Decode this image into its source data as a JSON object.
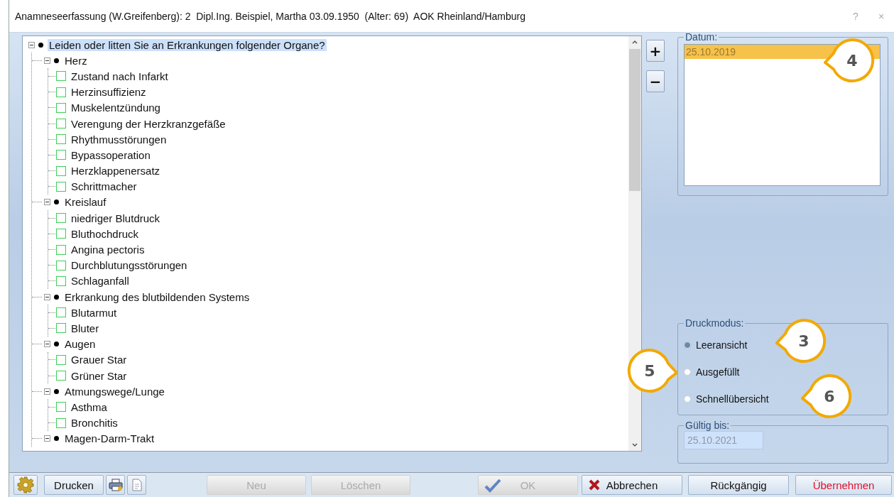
{
  "window": {
    "title": "Anamneseerfassung (W.Greifenberg): 2  Dipl.Ing. Beispiel, Martha 03.09.1950  (Alter: 69)  AOK Rheinland/Hamburg",
    "help": "?",
    "close": "×"
  },
  "tree": [
    {
      "label": "Leiden oder litten  Sie an Erkrankungen folgender Organe?",
      "expanded": true,
      "selected": true,
      "children": [
        {
          "label": "Herz",
          "expanded": true,
          "selected": false,
          "children": [
            {
              "label": "Zustand nach Infarkt",
              "checked": false,
              "selected": false
            },
            {
              "label": "Herzinsuffizienz",
              "checked": false,
              "selected": false
            },
            {
              "label": "Muskelentzündung",
              "checked": false,
              "selected": false
            },
            {
              "label": "Verengung der Herzkranzgefäße",
              "checked": false,
              "selected": false
            },
            {
              "label": "Rhythmusstörungen",
              "checked": false,
              "selected": false
            },
            {
              "label": "Bypassoperation",
              "checked": false,
              "selected": false
            },
            {
              "label": "Herzklappenersatz",
              "checked": false,
              "selected": false
            },
            {
              "label": "Schrittmacher",
              "checked": false,
              "selected": false
            }
          ]
        },
        {
          "label": "Kreislauf",
          "expanded": true,
          "selected": false,
          "children": [
            {
              "label": "niedriger Blutdruck",
              "checked": false,
              "selected": false
            },
            {
              "label": "Bluthochdruck",
              "checked": false,
              "selected": false
            },
            {
              "label": "Angina pectoris",
              "checked": false,
              "selected": false
            },
            {
              "label": "Durchblutungsstörungen",
              "checked": false,
              "selected": false
            },
            {
              "label": "Schlaganfall",
              "checked": false,
              "selected": false
            }
          ]
        },
        {
          "label": "Erkrankung des blutbildenden Systems",
          "expanded": true,
          "selected": false,
          "children": [
            {
              "label": "Blutarmut",
              "checked": false,
              "selected": false
            },
            {
              "label": "Bluter",
              "checked": false,
              "selected": false
            }
          ]
        },
        {
          "label": "Augen",
          "expanded": true,
          "selected": false,
          "children": [
            {
              "label": "Grauer Star",
              "checked": false,
              "selected": false
            },
            {
              "label": "Grüner Star",
              "checked": false,
              "selected": false
            }
          ]
        },
        {
          "label": "Atmungswege/Lunge",
          "expanded": true,
          "selected": false,
          "children": [
            {
              "label": "Asthma",
              "checked": false,
              "selected": false
            },
            {
              "label": "Bronchitis",
              "checked": false,
              "selected": false
            }
          ]
        },
        {
          "label": "Magen-Darm-Trakt",
          "expanded": true,
          "selected": false
        }
      ]
    }
  ],
  "zoom_buttons": [
    "+",
    "−"
  ],
  "datum": {
    "label": "Datum:",
    "items": [
      {
        "text": "25.10.2019",
        "selected": true
      }
    ]
  },
  "druckmodus": {
    "label": "Druckmodus:",
    "options": [
      {
        "label": "Leeransicht",
        "selected": true
      },
      {
        "label": "Ausgefüllt",
        "selected": false
      },
      {
        "label": "Schnellübersicht",
        "selected": false
      }
    ]
  },
  "gueltig_bis": {
    "label": "Gültig bis:",
    "value": "25.10.2021"
  },
  "buttons": [
    {
      "kind": "gear",
      "disabled": false
    },
    {
      "kind": "text",
      "label": "Drucken",
      "disabled": false
    },
    {
      "kind": "printer",
      "disabled": false
    },
    {
      "kind": "document",
      "disabled": false
    },
    {
      "kind": "text",
      "label": "Neu",
      "disabled": true
    },
    {
      "kind": "text",
      "label": "Löschen",
      "disabled": true
    },
    {
      "kind": "check",
      "label": "OK",
      "disabled": true
    },
    {
      "kind": "cross",
      "label": "Abbrechen",
      "disabled": false
    },
    {
      "kind": "text",
      "label": "Rückgängig",
      "disabled": false
    },
    {
      "kind": "text",
      "label": "Übernehmen",
      "disabled": false,
      "highlighted": true
    }
  ],
  "callouts": [
    {
      "number": "4",
      "pointer_right": false
    },
    {
      "number": "3",
      "pointer_right": false
    },
    {
      "number": "5",
      "pointer_right": true
    },
    {
      "number": "6",
      "pointer_right": false
    }
  ]
}
